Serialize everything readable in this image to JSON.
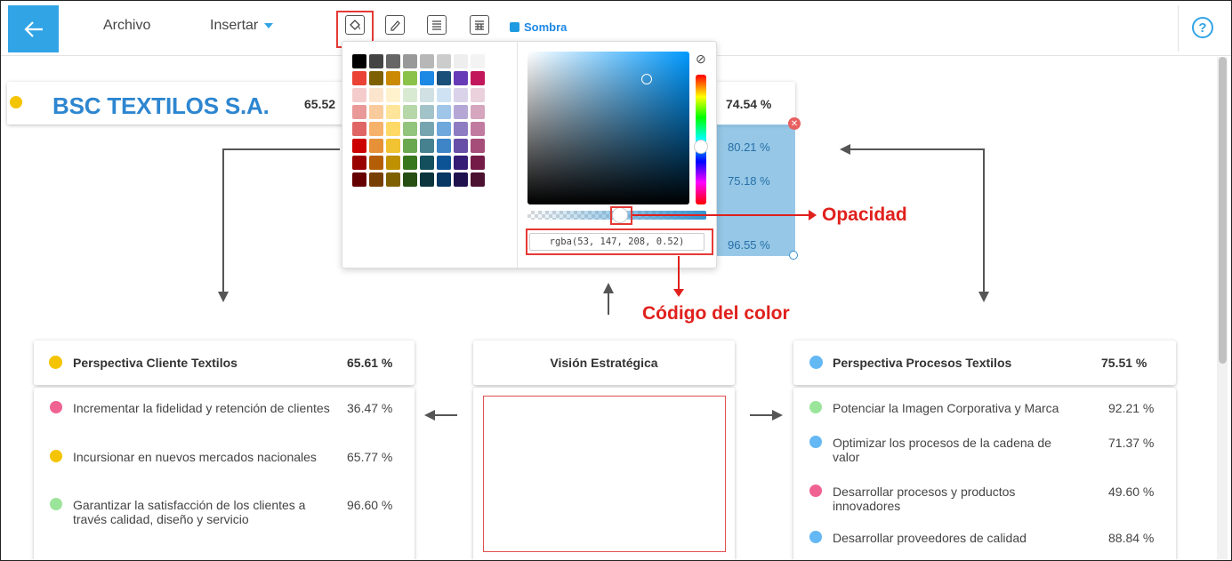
{
  "topbar": {
    "menu_archivo": "Archivo",
    "menu_insertar": "Insertar",
    "sombra_label": "Sombra",
    "help": "?"
  },
  "header": {
    "title": "BSC TEXTILOS S.A.",
    "value_left": "65.52",
    "value_right": "74.54  %"
  },
  "blue_shape": {
    "values": [
      "80.21  %",
      "75.18  %",
      "96.55  %"
    ],
    "color": "#3593d0"
  },
  "color_picker": {
    "rgba_value": "rgba(53, 147, 208, 0.52)",
    "clear_icon": "⊘",
    "swatches": [
      "#000000",
      "#444444",
      "#666666",
      "#999999",
      "#b7b7b7",
      "#cccccc",
      "#eeeeee",
      "#f3f3f3",
      "#ea4335",
      "#7f6000",
      "#ca8a04",
      "#8bc34a",
      "#1e88e5",
      "#1a4f7a",
      "#673ab7",
      "#c2185b",
      "#f4cccc",
      "#fce5cd",
      "#fff2cc",
      "#d9ead3",
      "#d0e0e3",
      "#cfe2f3",
      "#d9d2e9",
      "#ead1dc",
      "#ea9999",
      "#f9cb9c",
      "#ffe599",
      "#b6d7a8",
      "#a2c4c9",
      "#9fc5e8",
      "#b4a7d6",
      "#d5a6bd",
      "#e06666",
      "#f6b26b",
      "#ffd966",
      "#93c47d",
      "#76a5af",
      "#6fa8dc",
      "#8e7cc3",
      "#c27ba0",
      "#cc0000",
      "#e69138",
      "#f1c232",
      "#6aa84f",
      "#45818e",
      "#3d85c6",
      "#674ea7",
      "#a64d79",
      "#990000",
      "#b45f06",
      "#bf9000",
      "#38761d",
      "#134f5c",
      "#0b5394",
      "#351c75",
      "#741b47",
      "#660000",
      "#783f04",
      "#7f6000",
      "#274e13",
      "#0c343d",
      "#073763",
      "#20124d",
      "#4c1130"
    ]
  },
  "annotations": {
    "opacidad": "Opacidad",
    "codigo": "Código del color"
  },
  "cards": {
    "cliente": {
      "title": "Perspectiva Cliente Textilos",
      "value": "65.61  %",
      "dot_color": "#f5c400",
      "items": [
        {
          "text": "Incrementar la fidelidad y retención de clientes",
          "value": "36.47  %",
          "color": "#f06292"
        },
        {
          "text": "Incursionar en nuevos mercados nacionales",
          "value": "65.77  %",
          "color": "#f5c400"
        },
        {
          "text": "Garantizar la satisfacción de los clientes a través calidad, diseño y servicio",
          "value": "96.60  %",
          "color": "#9be59b"
        }
      ]
    },
    "vision": {
      "title": "Visión Estratégica"
    },
    "procesos": {
      "title": "Perspectiva Procesos Textilos",
      "value": "75.51  %",
      "dot_color": "#64b8f4",
      "items": [
        {
          "text": "Potenciar la Imagen Corporativa y Marca",
          "value": "92.21  %",
          "color": "#9be59b"
        },
        {
          "text": "Optimizar los procesos de la cadena de valor",
          "value": "71.37  %",
          "color": "#64b8f4"
        },
        {
          "text": "Desarrollar procesos y productos innovadores",
          "value": "49.60  %",
          "color": "#f06292"
        },
        {
          "text": "Desarrollar proveedores de calidad",
          "value": "88.84  %",
          "color": "#64b8f4"
        }
      ]
    }
  }
}
